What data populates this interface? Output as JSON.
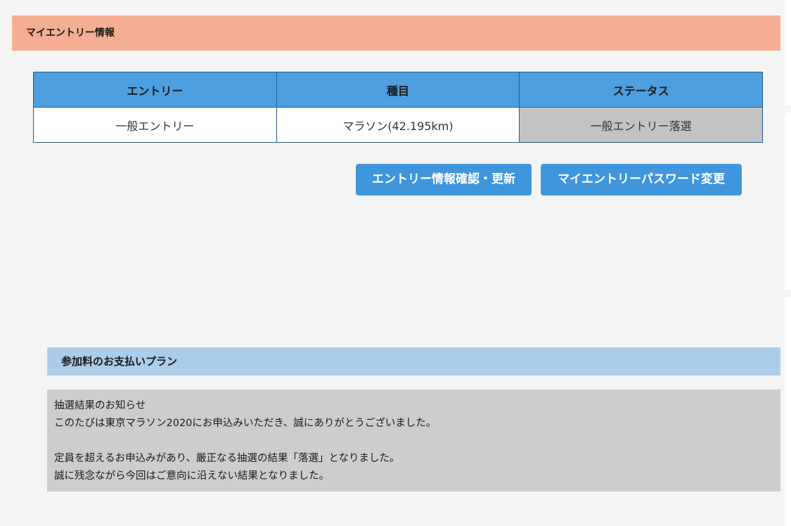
{
  "my_entry_section": {
    "title": "マイエントリー情報"
  },
  "entry_table": {
    "headers": [
      "エントリー",
      "種目",
      "ステータス"
    ],
    "rows": [
      [
        "一般エントリー",
        "マラソン(42.195km)",
        "一般エントリー落選"
      ]
    ]
  },
  "buttons": {
    "entry_info": "エントリー情報確認・更新",
    "password_change": "マイエントリーパスワード変更"
  },
  "payment_section": {
    "title": "参加料のお支払いプラン"
  },
  "notice": {
    "lines": [
      "抽選結果のお知らせ",
      "このたびは東京マラソン2020にお申込みいただき、誠にありがとうございました。",
      "定員を超えるお申込みがあり、厳正なる抽選の結果「落選」となりました。",
      "誠に残念ながら今回はご意向に沿えない結果となりました。"
    ]
  },
  "colors": {
    "entry_header_bg": "#f4ae94",
    "table_header_bg": "#4d9fe0",
    "status_cell_bg": "#c3c3c3",
    "button_bg": "#4096dd",
    "payment_header_bg": "#abcde9",
    "notice_bg": "#cdcdcd",
    "page_bg": "#f4f4f4"
  }
}
